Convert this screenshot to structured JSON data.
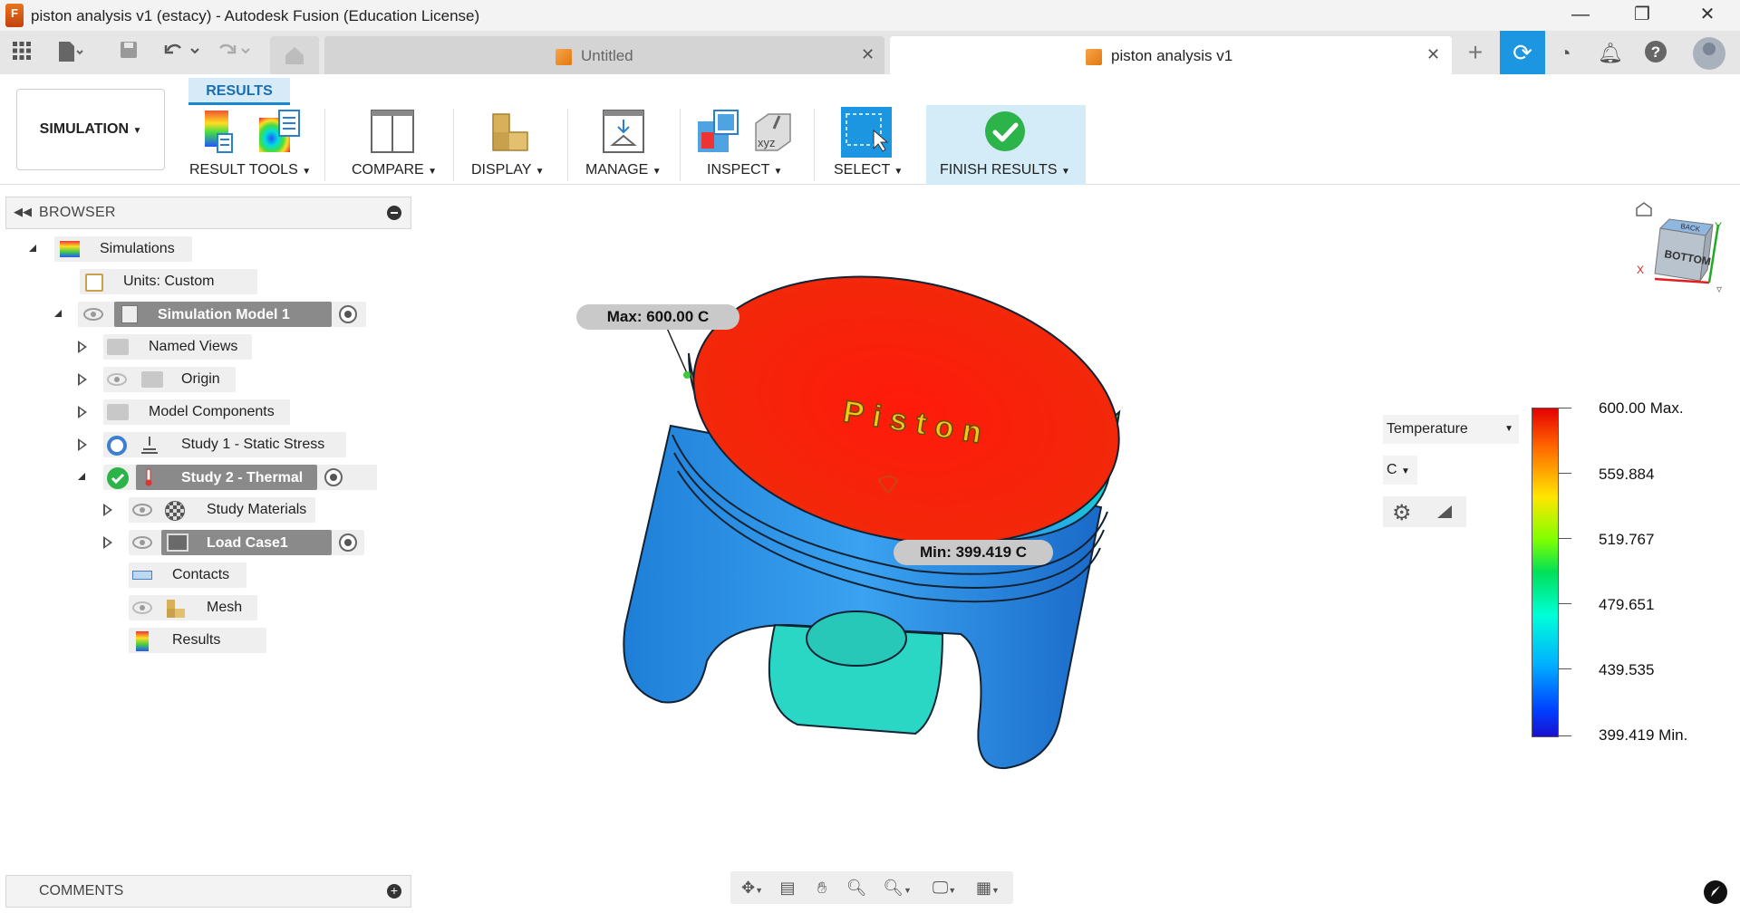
{
  "window": {
    "title": "piston analysis v1 (estacy) - Autodesk Fusion (Education License)",
    "app_logo_text": "F",
    "minimize": "—",
    "maximize": "❐",
    "close": "✕"
  },
  "tabs": [
    {
      "label": "Untitled",
      "active": false,
      "close": "✕"
    },
    {
      "label": "piston analysis v1",
      "active": true,
      "close": "✕"
    }
  ],
  "ribbon": {
    "workspace": "SIMULATION",
    "active_tab": "RESULTS",
    "groups": {
      "result_tools": "RESULT TOOLS",
      "compare": "COMPARE",
      "display": "DISPLAY",
      "manage": "MANAGE",
      "inspect": "INSPECT",
      "select": "SELECT",
      "finish": "FINISH RESULTS"
    }
  },
  "browser": {
    "title": "BROWSER",
    "items": [
      {
        "label": "Simulations"
      },
      {
        "label": "Units: Custom"
      },
      {
        "label": "Simulation Model 1"
      },
      {
        "label": "Named Views"
      },
      {
        "label": "Origin"
      },
      {
        "label": "Model Components"
      },
      {
        "label": "Study 1 - Static Stress"
      },
      {
        "label": "Study 2 - Thermal"
      },
      {
        "label": "Study Materials"
      },
      {
        "label": "Load Case1"
      },
      {
        "label": "Contacts"
      },
      {
        "label": "Mesh"
      },
      {
        "label": "Results"
      }
    ]
  },
  "comments": {
    "title": "COMMENTS"
  },
  "viewport": {
    "max_callout": "Max: 600.00 C",
    "min_callout": "Min: 399.419 C",
    "model_text": "Piston",
    "viewcube_face": "BOTTOM",
    "viewcube_top": "BACK",
    "axis_x": "X",
    "axis_y": "Y"
  },
  "legend": {
    "result_type": "Temperature",
    "unit": "C",
    "values": [
      "600.00 Max.",
      "559.884",
      "519.767",
      "479.651",
      "439.535",
      "399.419 Min."
    ],
    "colors": {
      "max": "#e60000",
      "min": "#1a10d0"
    }
  }
}
